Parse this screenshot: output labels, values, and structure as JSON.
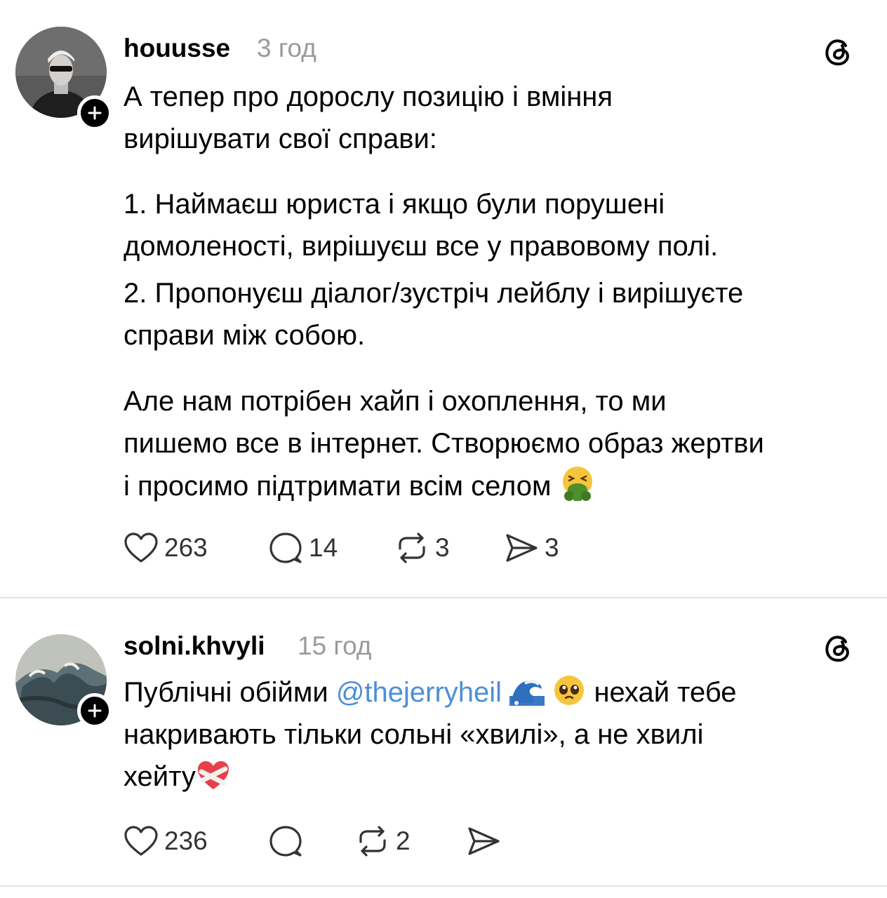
{
  "posts": [
    {
      "username": "houusse",
      "time": "3 год",
      "lines": [
        "А тепер про дорослу позицію і вміння",
        "вирішувати свої справи:",
        "1. Наймаєш юриста і якщо були порушені",
        "домоленості, вирішуєш все у правовому полі.",
        "2. Пропонуєш діалог/зустріч лейблу і вирішуєте",
        "справи між собою.",
        "Але нам потрібен хайп і охоплення, то ми",
        "пишемо все в інтернет. Створюємо образ жертви",
        "і просимо підтримати всім селом"
      ],
      "emoji": "vomiting-face-emoji",
      "likes": "263",
      "comments": "14",
      "reposts": "3",
      "shares": "3"
    },
    {
      "username": "solni.khvyli",
      "time": "15 год",
      "line1_before": "Публічні обійми ",
      "mention": "@thejerryheil",
      "line1_after": " нехай тебе",
      "line2": "накривають тільки сольні «хвилі», а не хвилі",
      "line3": "хейту",
      "emojis": [
        "wave-emoji",
        "pleading-face-emoji",
        "mending-heart-emoji"
      ],
      "likes": "236",
      "reposts": "2"
    }
  ],
  "colors": {
    "text": "#000000",
    "muted": "#9a9a9a",
    "mention": "#4a8fd8",
    "divider": "#e2e2e2"
  },
  "icons": [
    "follow-plus-icon",
    "threads-logo-icon",
    "heart-icon",
    "comment-icon",
    "repost-icon",
    "share-icon"
  ]
}
